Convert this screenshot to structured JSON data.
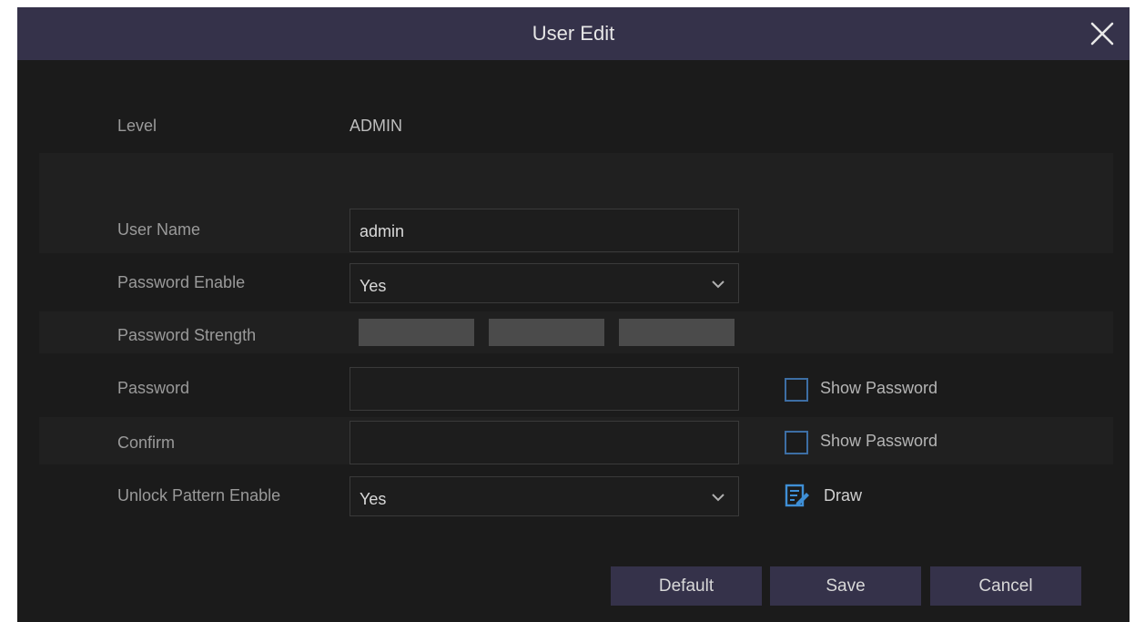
{
  "dialog": {
    "title": "User Edit",
    "close_icon": "close-icon"
  },
  "level": {
    "label": "Level",
    "value": "ADMIN"
  },
  "user_name": {
    "label": "User Name",
    "value": "admin"
  },
  "password_enable": {
    "label": "Password Enable",
    "value": "Yes"
  },
  "password_strength": {
    "label": "Password Strength",
    "bars": 3,
    "filled": 0
  },
  "password": {
    "label": "Password",
    "value": "",
    "show_label": "Show Password",
    "show_checked": false
  },
  "confirm": {
    "label": "Confirm",
    "value": "",
    "show_label": "Show Password",
    "show_checked": false
  },
  "unlock_pattern": {
    "label": "Unlock Pattern Enable",
    "value": "Yes",
    "draw_label": "Draw",
    "draw_icon": "pattern-draw-icon"
  },
  "buttons": {
    "default": "Default",
    "save": "Save",
    "cancel": "Cancel"
  },
  "colors": {
    "titlebar": "#35324a",
    "background": "#1b1b1b",
    "checkbox_border": "#3d6ea4",
    "draw_icon": "#3f8fd6"
  }
}
